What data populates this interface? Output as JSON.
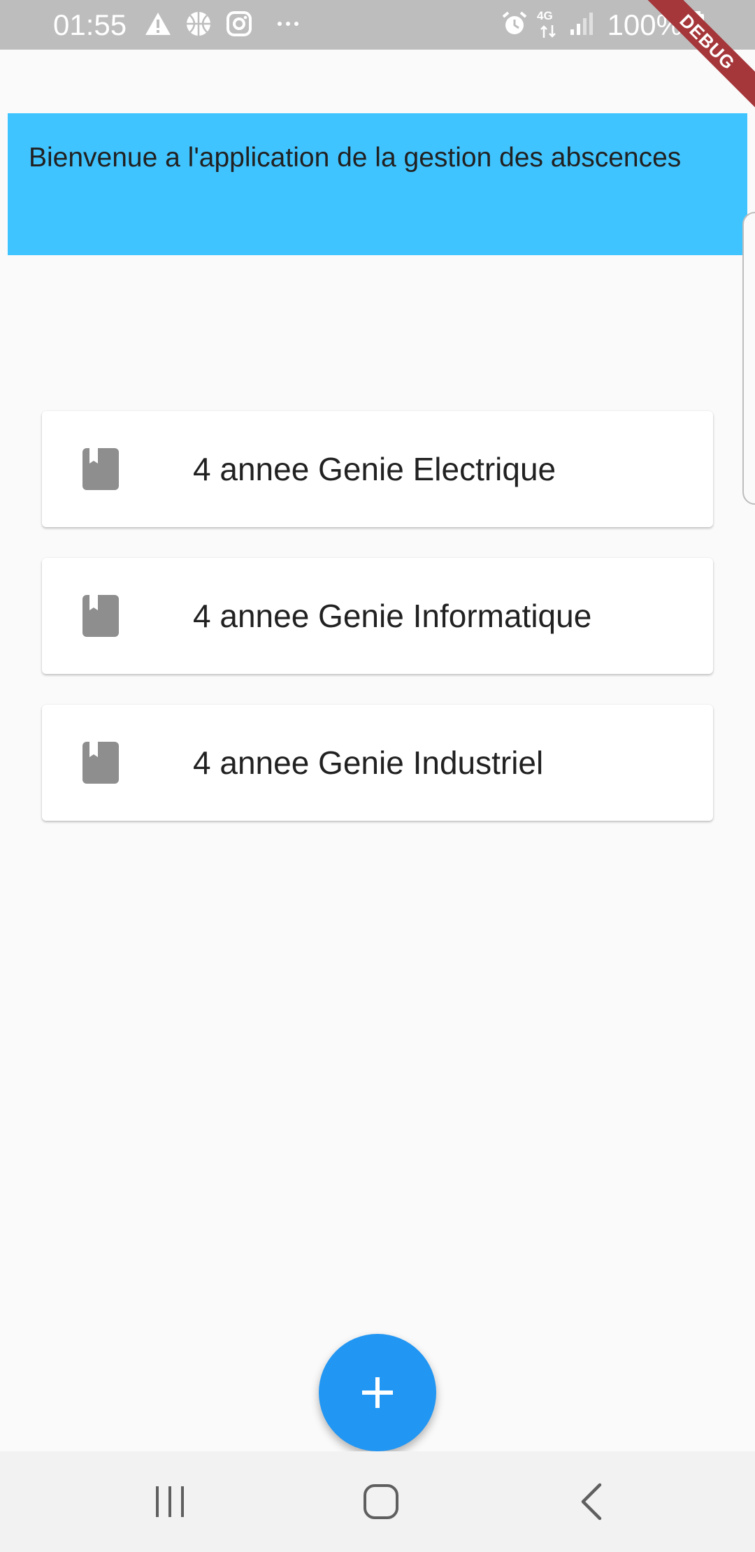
{
  "status_bar": {
    "time": "01:55",
    "network": "4G",
    "battery": "100%",
    "icons": [
      "warning-icon",
      "basketball-icon",
      "instagram-icon",
      "more-dots-icon",
      "alarm-icon",
      "network-4g-icon",
      "signal-icon",
      "battery-icon"
    ]
  },
  "debug_banner": {
    "label": "DEBUG"
  },
  "header": {
    "welcome_text": "Bienvenue a l'application de la gestion des abscences",
    "color": "#40c4ff"
  },
  "classes": [
    {
      "icon": "book-icon",
      "title": "4 annee Genie Electrique"
    },
    {
      "icon": "book-icon",
      "title": "4 annee Genie Informatique"
    },
    {
      "icon": "book-icon",
      "title": "4 annee Genie Industriel"
    }
  ],
  "fab": {
    "icon": "add-icon",
    "color": "#2196f3"
  },
  "nav_bar": {
    "buttons": [
      "recent-apps-icon",
      "home-icon",
      "back-icon"
    ]
  }
}
